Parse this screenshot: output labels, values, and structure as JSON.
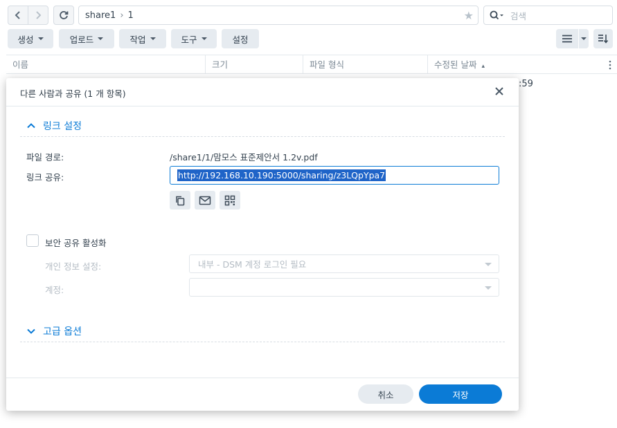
{
  "toolbar": {
    "path": {
      "root": "share1",
      "separator": "›",
      "folder": "1"
    },
    "search_placeholder": "검색",
    "buttons": {
      "create": "생성",
      "upload": "업로드",
      "action": "작업",
      "tools": "도구",
      "settings": "설정"
    }
  },
  "table": {
    "columns": {
      "name": "이름",
      "size": "크기",
      "type": "파일 형식",
      "modified": "수정된 날짜"
    },
    "sort_indicator": "▴",
    "row_fragment": ":59"
  },
  "dialog": {
    "title": "다른 사람과 공유 (1 개 항목)",
    "link_section": "링크 설정",
    "file_path_label": "파일 경로:",
    "file_path_value": "/share1/1/맘모스 표준제안서 1.2v.pdf",
    "link_label": "링크 공유:",
    "link_value": "http://192.168.10.190:5000/sharing/z3LQpYpa7",
    "secure_share_label": "보안 공유 활성화",
    "privacy_label": "개인 정보 설정:",
    "privacy_value": "내부 - DSM 계정 로그인 필요",
    "account_label": "계정:",
    "account_value": "",
    "advanced_section": "고급 옵션",
    "cancel": "취소",
    "save": "저장"
  },
  "colors": {
    "accent": "#0b7bd6",
    "selection": "#1f64c8"
  },
  "icons": [
    "chevron-left-icon",
    "chevron-right-icon",
    "refresh-icon",
    "star-icon",
    "search-icon",
    "list-view-icon",
    "sort-icon",
    "more-icon",
    "close-icon",
    "chevron-up-icon",
    "chevron-down-icon",
    "copy-icon",
    "mail-icon",
    "qr-code-icon"
  ]
}
